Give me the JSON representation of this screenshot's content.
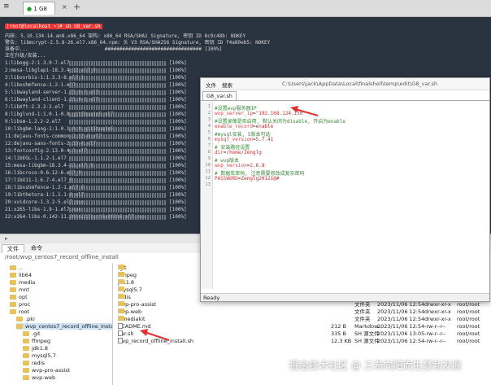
{
  "tabbar": {
    "menu_glyph": "≡",
    "tab_label": "1 G8",
    "tab_dot": "●",
    "close_glyph": "×",
    "add_glyph": "+"
  },
  "terminal": {
    "warning": "[root@localhost ~]# sh G8_var.sh",
    "lines": [
      "内核: 5.10.134-14.an8.x86_64 架构: x86_64 RSA/SHA1 Signature, 密钥 ID 8c9c48b: NOKEY",
      "警告: libmcrypt-2.5.8-26.el7.x86_64.rpm: 头 V3 RSA/SHA256 Signature, 密钥 ID f4a80eb5: NOKEY",
      "准备中...                          ################################# [100%]",
      "正在升级/安装..."
    ],
    "pkgs": [
      "1:libogg-2:1.3.0-7.el7",
      "2:mesa-libglapi-18.3.4-12.el7_9",
      "3:libvorbis-1:1.3.3-8.el7.1",
      "4:libxshmfence-1.2-1.el7",
      "5:libwayland-server-1.15.0-1.el7",
      "6:libwayland-client-1.15.0-1.el7",
      "7:libXft-2.3.2-2.el7",
      "8:libglvnd-1:1.0.1-0.8.git5baa1e5.el7",
      "9:libsm-1.2.2-2.el7",
      "10:libgbm-lang-1:1.0.1-0.8.git5baa1e5",
      "11:dejavu-fonts-common-2.33-6.el7",
      "12:dejavu-sans-fonts-2.33-6.el7",
      "13:fontconfig-2.13.0-4.3.el7",
      "14:libEGL-1.1.2-1.el7",
      "15:mesa-libgbm-18.3.4-12.el7_9",
      "16:libcroco-0.6.12-6.el7_9",
      "17:libX11-1.6.7-4.el7_9",
      "18:libxshmfence-1.2-1.el7_9",
      "19:libthetora-1:1.1.1-8.el7",
      "20:xvidcore-1.3.2-5.el7.nux",
      "21:x265-libs-1.9-1.el7.nux",
      "22:x264-libs-0.142-11.20141221git6a301b6.el7.nux"
    ],
    "pct": "[100%]"
  },
  "filemanager": {
    "tabs": [
      "文件",
      "命令"
    ],
    "path": "/root/wvp_centos7_record_offline_install",
    "tree": [
      {
        "label": "..",
        "indent": 12
      },
      {
        "label": "lib64",
        "indent": 12
      },
      {
        "label": "media",
        "indent": 12
      },
      {
        "label": "mnt",
        "indent": 12
      },
      {
        "label": "opt",
        "indent": 12
      },
      {
        "label": "proc",
        "indent": 12
      },
      {
        "label": "root",
        "indent": 12
      },
      {
        "label": ".pki",
        "indent": 20
      },
      {
        "label": "wvp_centos7_record_offline_install",
        "indent": 20
      },
      {
        "label": ".git",
        "indent": 28
      },
      {
        "label": "ffmpeg",
        "indent": 28
      },
      {
        "label": "jdk1.8",
        "indent": 28
      },
      {
        "label": "mysql5.7",
        "indent": 28
      },
      {
        "label": "redis",
        "indent": 28
      },
      {
        "label": "wvp-pro-assist",
        "indent": 28
      },
      {
        "label": "wvp-web",
        "indent": 28
      }
    ],
    "files": [
      {
        "name": ".git",
        "size": "",
        "type": "文件夹",
        "date": "2023/11/06 12:54",
        "perm": "drwxr-xr-x",
        "owner": "root/root",
        "dir": true
      },
      {
        "name": "ffmpeg",
        "size": "",
        "type": "文件夹",
        "date": "2023/11/06 12:54",
        "perm": "drwxr-xr-x",
        "owner": "root/root",
        "dir": true
      },
      {
        "name": "jdk1.8",
        "size": "",
        "type": "文件夹",
        "date": "2023/11/06 12:54",
        "perm": "drwxr-xr-x",
        "owner": "root/root",
        "dir": true
      },
      {
        "name": "mysql5.7",
        "size": "",
        "type": "文件夹",
        "date": "2023/11/06 12:54",
        "perm": "drwxr-xr-x",
        "owner": "root/root",
        "dir": true
      },
      {
        "name": "redis",
        "size": "",
        "type": "文件夹",
        "date": "2023/11/06 12:54",
        "perm": "drwxr-xr-x",
        "owner": "root/root",
        "dir": true
      },
      {
        "name": "wvp-pro-assist",
        "size": "",
        "type": "文件夹",
        "date": "2023/11/06 12:54",
        "perm": "drwxr-xr-x",
        "owner": "root/root",
        "dir": true
      },
      {
        "name": "wvp-web",
        "size": "",
        "type": "文件夹",
        "date": "2023/11/06 12:54",
        "perm": "drwxr-xr-x",
        "owner": "root/root",
        "dir": true
      },
      {
        "name": "zlmediakit",
        "size": "",
        "type": "文件夹",
        "date": "2023/11/06 12:54",
        "perm": "drwxr-xr-x",
        "owner": "root/root",
        "dir": true
      },
      {
        "name": "README.md",
        "size": "212 B",
        "type": "Markdow...",
        "date": "2023/11/06 12:54",
        "perm": "-rw-r--r--",
        "owner": "root/root",
        "dir": false
      },
      {
        "name": "var.sh",
        "size": "335 B",
        "type": "SH 源文件",
        "date": "2023/11/06 13:05",
        "perm": "-rw-r--r--",
        "owner": "root/root",
        "dir": false
      },
      {
        "name": "wvp_record_offline_install.sh",
        "size": "12.3 KB",
        "type": "SH 源文件",
        "date": "2023/11/06 12:54",
        "perm": "-rw-r--r--",
        "owner": "root/root",
        "dir": false
      }
    ]
  },
  "editor": {
    "menu": [
      "文件",
      "搜索"
    ],
    "path": "C:\\Users\\jack\\AppData\\Local\\finalshell\\temp\\edit\\G8_var.sh",
    "winbtns": [
      "—",
      "□",
      "✕"
    ],
    "filetab": "G8_var.sh",
    "line_numbers": [
      "1",
      "2",
      "3",
      "4",
      "5",
      "6",
      "7",
      "8",
      "9",
      "10",
      "11",
      "12",
      "13"
    ],
    "code": [
      {
        "t": "cmt",
        "s": "#设置wvp服务器IP"
      },
      {
        "t": "kv",
        "k": "wvp_server_ip",
        "v": "\"192.168.124.150\""
      },
      {
        "t": "cmt",
        "s": "#设置录像是否启用, 默认关闭为disable, 开启为enable"
      },
      {
        "t": "kv",
        "k": "enable_record",
        "v": "enable"
      },
      {
        "t": "cmt",
        "s": "#mysql安装, 5版本可选"
      },
      {
        "t": "kv",
        "k": "mysql_version",
        "v": "5.7.41"
      },
      {
        "t": "cmt",
        "s": "# 安装路径设置"
      },
      {
        "t": "kv",
        "k": "dir",
        "v": "/home/Zenglg"
      },
      {
        "t": "cmt",
        "s": "# wvp版本"
      },
      {
        "t": "kv",
        "k": "wvp_version",
        "v": "2.6.8"
      },
      {
        "t": "cmt",
        "s": "# 数据库密码, 注意需要修改成复杂密码"
      },
      {
        "t": "kv",
        "k": "PASSWORD",
        "v": "Zenglg20121@#"
      },
      {
        "t": "cmt",
        "s": ""
      }
    ],
    "status": "Ready"
  },
  "watermark": "掘金技术社区 @ 三希向阳而生蔓勃发展",
  "colors": {
    "terminal_bg": "#2a3340",
    "accent_red": "#e03030",
    "comment_green": "#3a8a3a"
  }
}
